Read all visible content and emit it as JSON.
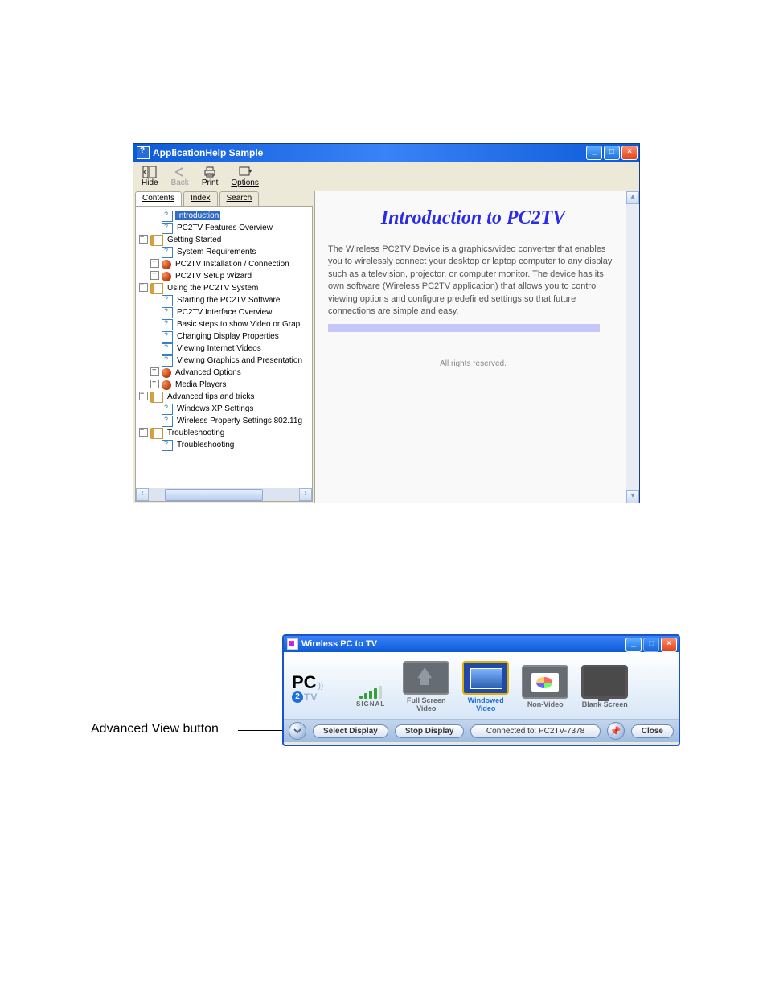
{
  "help": {
    "title": "ApplicationHelp Sample",
    "toolbar": {
      "hide": "Hide",
      "back": "Back",
      "print": "Print",
      "options": "Options"
    },
    "tabs": {
      "contents": "Contents",
      "index": "Index",
      "search": "Search"
    },
    "tree": {
      "intro": "Introduction",
      "features": "PC2TV Features Overview",
      "getting_started": "Getting Started",
      "sysreq": "System Requirements",
      "install": "PC2TV Installation / Connection",
      "setup_wizard": "PC2TV Setup Wizard",
      "using": "Using the PC2TV System",
      "starting": "Starting the PC2TV Software",
      "interface_overview": "PC2TV Interface Overview",
      "basic_steps": "Basic steps to show Video or Grap",
      "changing_display": "Changing Display Properties",
      "viewing_internet": "Viewing Internet Videos",
      "viewing_graphics": "Viewing Graphics and Presentation",
      "advanced_options": "Advanced Options",
      "media_players": "Media Players",
      "tips": "Advanced tips and tricks",
      "xp_settings": "Windows XP Settings",
      "wireless_prop": "Wireless Property Settings 802.11g",
      "troubleshooting_section": "Troubleshooting",
      "troubleshooting_page": "Troubleshooting"
    },
    "content": {
      "heading": "Introduction to PC2TV",
      "para": "The Wireless PC2TV Device is a graphics/video converter that enables you to wirelessly connect your desktop or laptop computer to any display such as a television, projector, or computer monitor. The device has its own software (Wireless PC2TV application) that allows you to control viewing options and configure predefined settings so that future connections are simple and easy.",
      "rights": "All rights reserved."
    }
  },
  "label_advanced_view": "Advanced View button",
  "app": {
    "title": "Wireless PC to TV",
    "logo_pc": "PC",
    "logo_2": "2",
    "logo_tv": "TV",
    "signal_label": "SIGNAL",
    "modes": {
      "full_screen": "Full Screen Video",
      "windowed": "Windowed Video",
      "non_video": "Non-Video",
      "blank": "Blank Screen"
    },
    "footer": {
      "select_display": "Select Display",
      "stop_display": "Stop Display",
      "status": "Connected to: PC2TV-7378",
      "close": "Close"
    }
  },
  "win_controls": {
    "min": "_",
    "max": "□",
    "close": "×"
  }
}
